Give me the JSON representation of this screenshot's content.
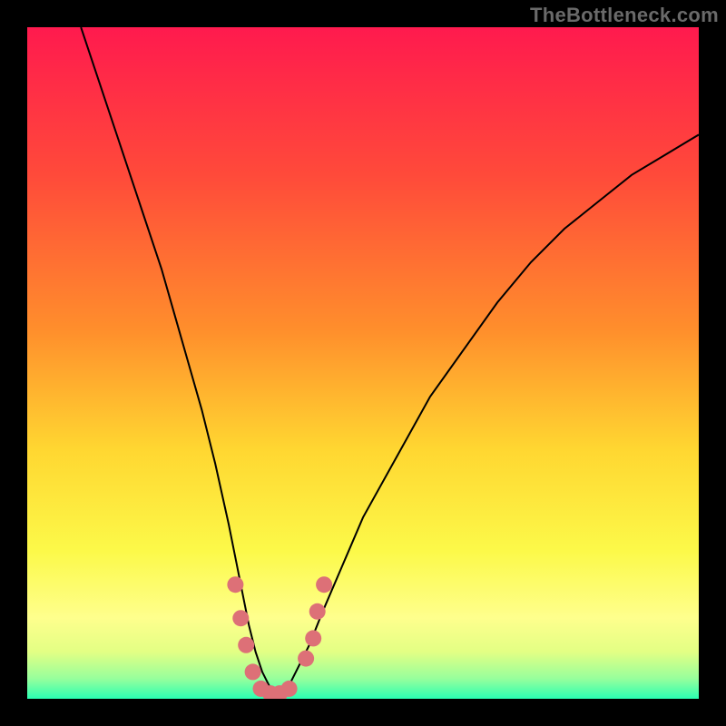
{
  "watermark": {
    "text": "TheBottleneck.com"
  },
  "chart_data": {
    "type": "line",
    "title": "",
    "xlabel": "",
    "ylabel": "",
    "x_range": [
      0,
      100
    ],
    "y_range": [
      0,
      100
    ],
    "grid": false,
    "legend": false,
    "background_gradient": {
      "direction": "vertical",
      "stops": [
        {
          "pos": 0.0,
          "color": "#ff1a4e"
        },
        {
          "pos": 0.22,
          "color": "#ff4a3a"
        },
        {
          "pos": 0.45,
          "color": "#ff8e2c"
        },
        {
          "pos": 0.63,
          "color": "#ffd731"
        },
        {
          "pos": 0.78,
          "color": "#fcf949"
        },
        {
          "pos": 0.88,
          "color": "#feff8d"
        },
        {
          "pos": 0.93,
          "color": "#e3ff84"
        },
        {
          "pos": 0.97,
          "color": "#97ff9c"
        },
        {
          "pos": 1.0,
          "color": "#2affb2"
        }
      ]
    },
    "series": [
      {
        "name": "bottleneck-curve",
        "color": "#000000",
        "stroke_width": 2,
        "x": [
          8,
          10,
          12,
          14,
          16,
          18,
          20,
          22,
          24,
          26,
          28,
          30,
          31,
          32,
          33,
          34,
          35,
          36,
          37,
          38,
          39,
          40,
          42,
          44,
          47,
          50,
          55,
          60,
          65,
          70,
          75,
          80,
          85,
          90,
          95,
          100
        ],
        "y": [
          100,
          94,
          88,
          82,
          76,
          70,
          64,
          57,
          50,
          43,
          35,
          26,
          21,
          16,
          11,
          7,
          4,
          2,
          1,
          1,
          2,
          4,
          8,
          13,
          20,
          27,
          36,
          45,
          52,
          59,
          65,
          70,
          74,
          78,
          81,
          84
        ]
      }
    ],
    "highlight_points": {
      "name": "near-zero-markers",
      "color": "#dd7077",
      "radius_px": 9,
      "points": [
        {
          "x": 31.0,
          "y": 17
        },
        {
          "x": 31.8,
          "y": 12
        },
        {
          "x": 32.6,
          "y": 8
        },
        {
          "x": 33.6,
          "y": 4
        },
        {
          "x": 34.8,
          "y": 1.5
        },
        {
          "x": 36.2,
          "y": 0.8
        },
        {
          "x": 37.6,
          "y": 0.8
        },
        {
          "x": 39.0,
          "y": 1.5
        },
        {
          "x": 41.5,
          "y": 6
        },
        {
          "x": 42.6,
          "y": 9
        },
        {
          "x": 43.2,
          "y": 13
        },
        {
          "x": 44.2,
          "y": 17
        }
      ]
    }
  }
}
